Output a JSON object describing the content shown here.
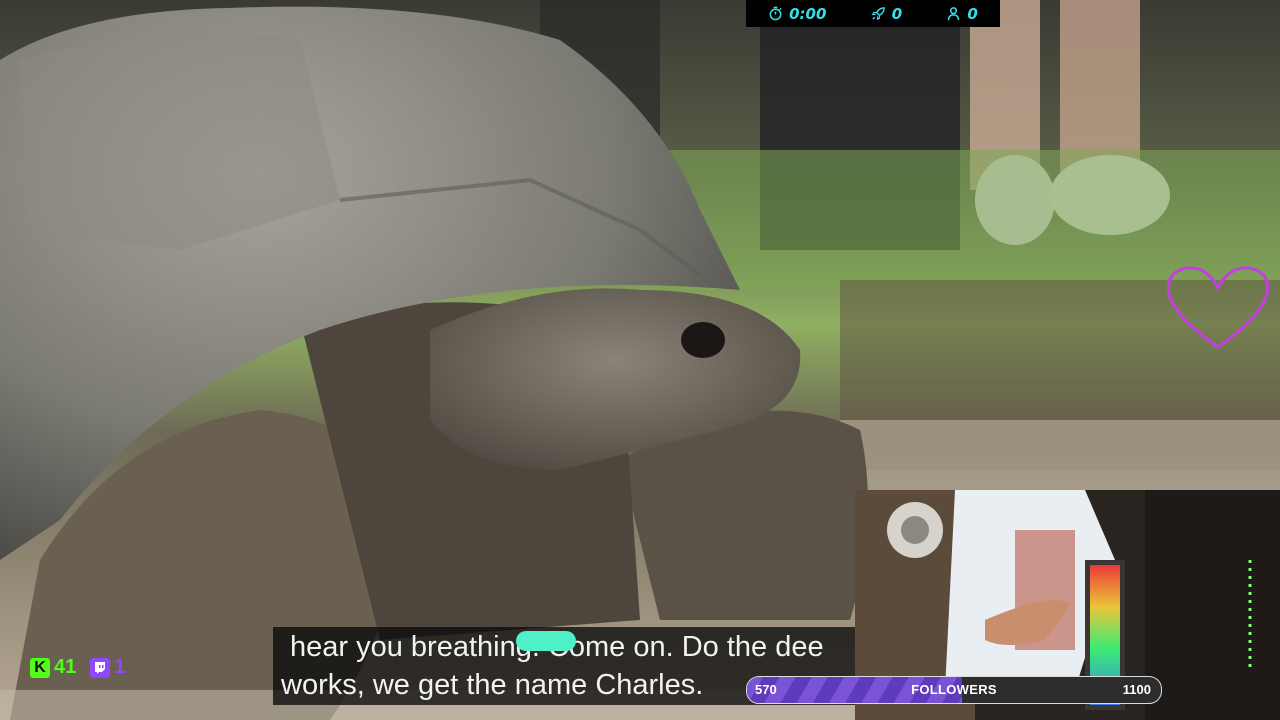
{
  "stats": {
    "timer": "0:00",
    "boosts": "0",
    "viewers": "0",
    "accent_color": "#36e0e8"
  },
  "captions": {
    "line1": "hear you breathing. Come on. Do the dee",
    "line2": "works, we get the name Charles. "
  },
  "followers": {
    "current": "570",
    "label": "FOLLOWERS",
    "goal": "1100",
    "progress": 0.52
  },
  "badges": {
    "kick_count": "41",
    "kick_letter": "K",
    "twitch_count": "1",
    "kick_color": "#53fc18",
    "twitch_color": "#9146ff"
  },
  "icons": {
    "timer": "stopwatch-icon",
    "boosts": "rocket-icon",
    "viewers": "person-icon",
    "overlay": "heart-outline-icon"
  }
}
